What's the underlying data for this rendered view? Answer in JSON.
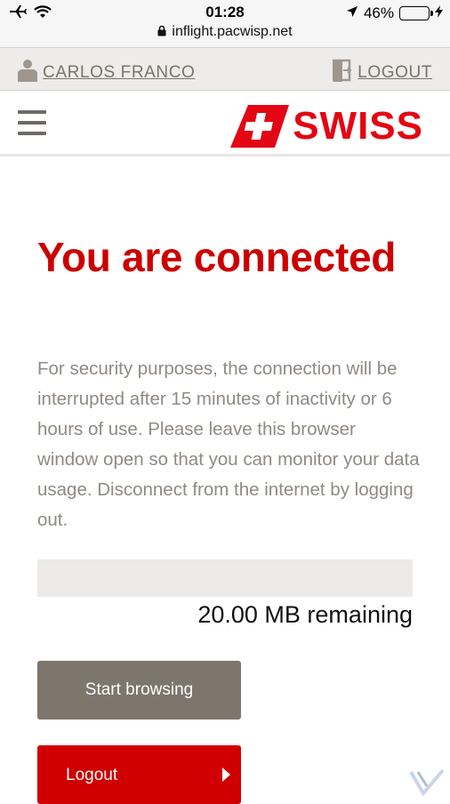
{
  "status_bar": {
    "time": "01:28",
    "battery_percent": "46%",
    "battery_level": 0.46,
    "url": "inflight.pacwisp.net",
    "icons": [
      "airplane-icon",
      "wifi-icon",
      "location-icon",
      "battery-icon",
      "charging-icon",
      "lock-icon"
    ]
  },
  "user_bar": {
    "user_name": "CARLOS FRANCO",
    "logout_label": "LOGOUT"
  },
  "header": {
    "logo_text": "SWISS",
    "menu_icon": "hamburger-menu-icon"
  },
  "main": {
    "title": "You are connected",
    "info": "For security purposes, the connection will be interrupted after 15 minutes of inactivity or 6 hours of use. Please leave this browser window open so that you can monitor your data usage. Disconnect from the internet by logging out.",
    "data_used_fraction": 0.0,
    "remaining": "20.00 MB remaining",
    "start_button": "Start browsing",
    "logout_button": "Logout"
  },
  "colors": {
    "brand_red": "#cc0000",
    "button_grey": "#7e756d",
    "logout_red": "#d00000",
    "text_grey": "#8f8a85"
  }
}
